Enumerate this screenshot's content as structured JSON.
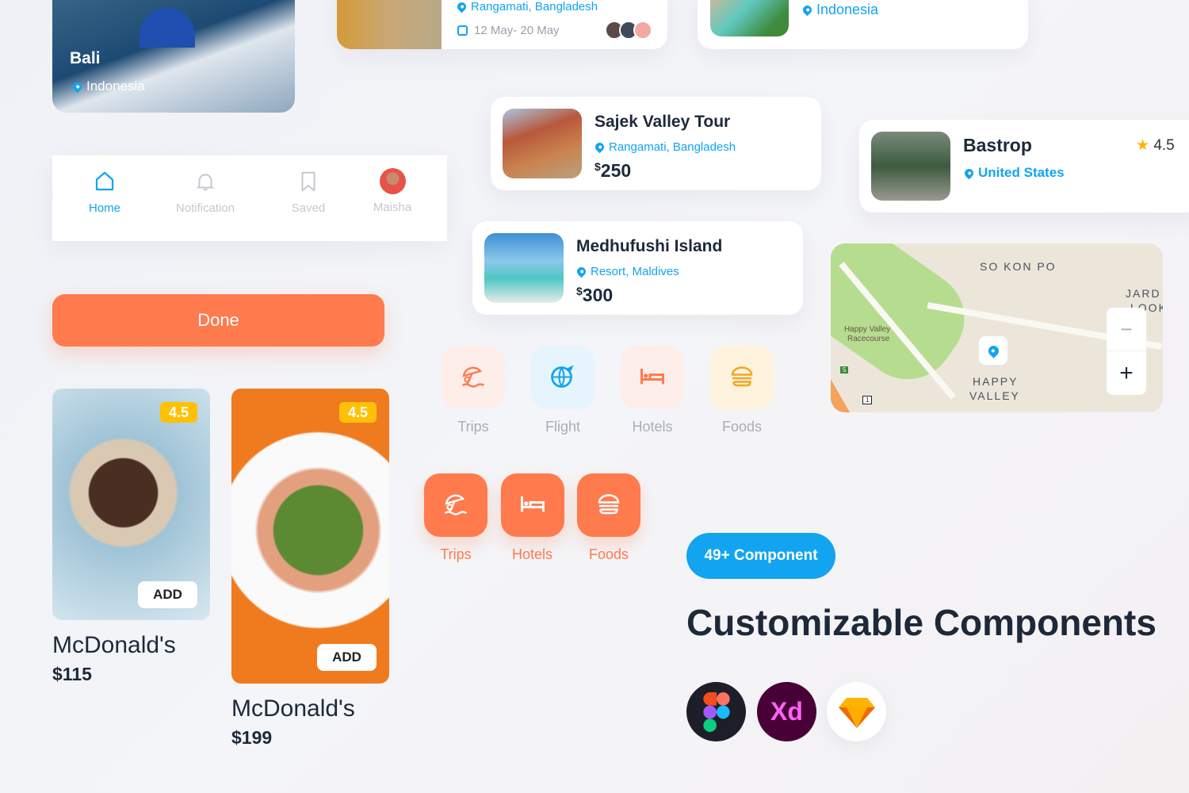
{
  "bali_card": {
    "title": "Bali",
    "location": "Indonesia"
  },
  "trip_card": {
    "location": "Rangamati, Bangladesh",
    "dates": "12 May- 20 May"
  },
  "indonesia_card": {
    "location": "Indonesia"
  },
  "nav": {
    "items": [
      {
        "label": "Home",
        "icon": "home-icon",
        "active": true
      },
      {
        "label": "Notification",
        "icon": "bell-icon"
      },
      {
        "label": "Saved",
        "icon": "bookmark-icon"
      },
      {
        "label": "Maisha",
        "icon": "avatar"
      }
    ]
  },
  "done_button": "Done",
  "sajek": {
    "title": "Sajek Valley Tour",
    "location": "Rangamati, Bangladesh",
    "currency": "$",
    "price": "250"
  },
  "bastrop": {
    "title": "Bastrop",
    "location": "United States",
    "rating": "4.5"
  },
  "medhufushi": {
    "title": "Medhufushi Island",
    "location": "Resort, Maldives",
    "currency": "$",
    "price": "300"
  },
  "map": {
    "labels": [
      "SO KON PO",
      "JARD",
      "LOOK",
      "Happy Valley",
      "Racecourse",
      "HAPPY",
      "VALLEY",
      "5",
      "1"
    ],
    "zoom_out": "−",
    "zoom_in": "+"
  },
  "categories_light": [
    {
      "label": "Trips",
      "icon": "beach-umbrella-icon"
    },
    {
      "label": "Flight",
      "icon": "globe-plane-icon"
    },
    {
      "label": "Hotels",
      "icon": "bed-icon"
    },
    {
      "label": "Foods",
      "icon": "burger-icon"
    }
  ],
  "categories_solid": [
    {
      "label": "Trips",
      "icon": "beach-umbrella-icon"
    },
    {
      "label": "Hotels",
      "icon": "bed-icon"
    },
    {
      "label": "Foods",
      "icon": "burger-icon"
    }
  ],
  "foods": [
    {
      "rating": "4.5",
      "add": "ADD",
      "name": "McDonald's",
      "price": "$115"
    },
    {
      "rating": "4.5",
      "add": "ADD",
      "name": "McDonald's",
      "price": "$199"
    }
  ],
  "component_badge": "49+ Component",
  "headline": "Customizable Components",
  "tools": [
    {
      "name": "Figma"
    },
    {
      "name": "Xd"
    },
    {
      "name": "Sketch"
    }
  ],
  "colors": {
    "accent": "#FF7A4D",
    "blue": "#12A4F0",
    "rating": "#FFC107"
  }
}
